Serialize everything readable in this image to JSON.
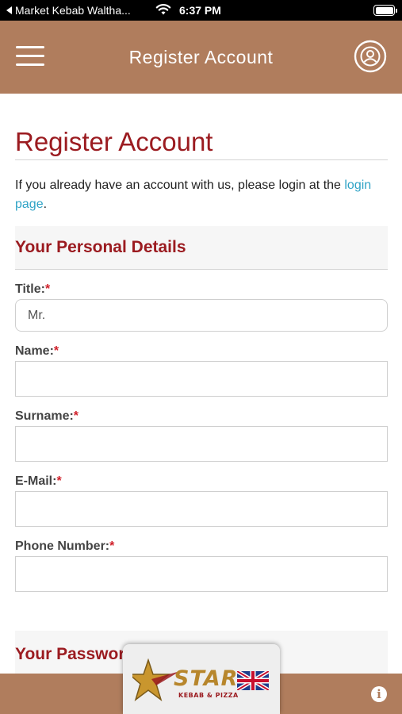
{
  "status_bar": {
    "back_app": "Market Kebab Waltha...",
    "time": "6:37 PM"
  },
  "header": {
    "title": "Register Account",
    "menu_icon": "hamburger-menu-icon",
    "account_icon": "user-circle-icon"
  },
  "page": {
    "title": "Register Account",
    "intro_text": "If you already have an account with us, please login at the ",
    "intro_link": "login page",
    "intro_end": "."
  },
  "personal_details": {
    "heading": "Your Personal Details",
    "title_label": "Title:",
    "title_value": "Mr.",
    "name_label": "Name:",
    "name_value": "",
    "surname_label": "Surname:",
    "surname_value": "",
    "email_label": "E-Mail:",
    "email_value": "",
    "phone_label": "Phone Number:",
    "phone_value": "",
    "required_mark": "*"
  },
  "password_section": {
    "heading": "Your Password"
  },
  "bottom_bar": {
    "logo_text": "STAR",
    "logo_sub": "KEBAB & PIZZA",
    "info_icon": "info-icon"
  },
  "colors": {
    "brand": "#b07d5d",
    "heading_red": "#9b1b20",
    "link": "#2fa3c6"
  }
}
